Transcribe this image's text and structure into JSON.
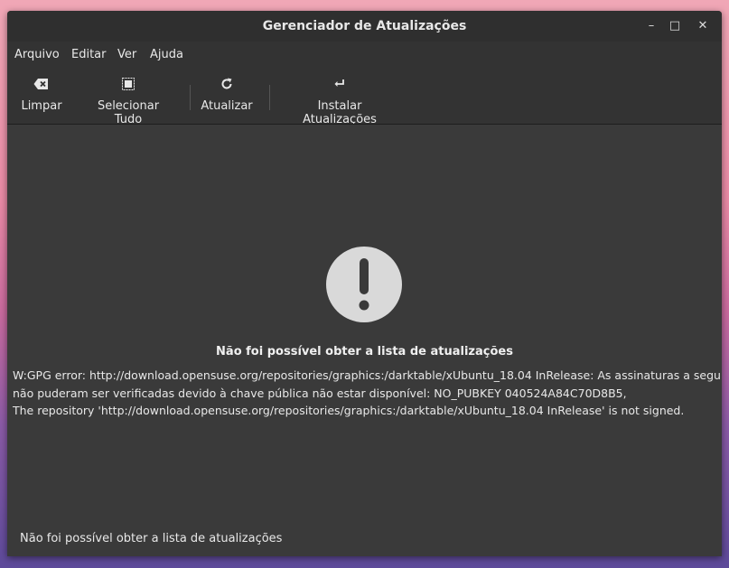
{
  "window": {
    "title": "Gerenciador de Atualizações"
  },
  "window_controls": {
    "minimize": "–",
    "maximize": "□",
    "close": "✕"
  },
  "menu": {
    "items": [
      {
        "label": "Arquivo"
      },
      {
        "label": "Editar"
      },
      {
        "label": "Ver"
      },
      {
        "label": "Ajuda"
      }
    ]
  },
  "toolbar": {
    "clear_label": "Limpar",
    "select_all_label": "Selecionar Tudo",
    "refresh_label": "Atualizar",
    "install_label": "Instalar Atualizações"
  },
  "icons": {
    "clear": "backspace-icon",
    "select_all": "select-all-icon",
    "refresh": "refresh-icon",
    "install": "return-arrow-icon",
    "error": "exclamation-circle-icon"
  },
  "error": {
    "heading": "Não foi possível obter a lista de atualizações",
    "lines": [
      "W:GPG error: http://download.opensuse.org/repositories/graphics:/darktable/xUbuntu_18.04  InRelease: As assinaturas a seguir",
      "não puderam ser verificadas devido à chave pública não estar disponível: NO_PUBKEY 040524A84C70D8B5,",
      "The repository 'http://download.opensuse.org/repositories/graphics:/darktable/xUbuntu_18.04  InRelease' is not signed."
    ]
  },
  "statusbar": {
    "text": "Não foi possível obter a lista de atualizações"
  },
  "colors": {
    "window_bg": "#333333",
    "content_bg": "#3a3a3a",
    "text": "#e8e8e8",
    "error_icon": "#d9d9d9"
  }
}
